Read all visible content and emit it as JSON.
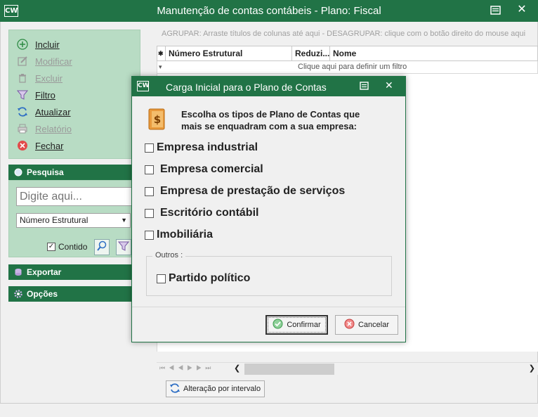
{
  "window": {
    "logo": "CW",
    "title": "Manutenção de contas contábeis - Plano: Fiscal",
    "close_glyph": "✕"
  },
  "actions": [
    {
      "label": "Incluir",
      "enabled": true,
      "icon": "plus-circle-icon"
    },
    {
      "label": "Modificar",
      "enabled": false,
      "icon": "edit-icon"
    },
    {
      "label": "Excluir",
      "enabled": false,
      "icon": "trash-icon"
    },
    {
      "label": "Filtro",
      "enabled": true,
      "icon": "filter-icon"
    },
    {
      "label": "Atualizar",
      "enabled": true,
      "icon": "refresh-icon"
    },
    {
      "label": "Relatório",
      "enabled": false,
      "icon": "printer-icon"
    },
    {
      "label": "Fechar",
      "enabled": true,
      "icon": "close-circle-icon"
    }
  ],
  "pesquisa": {
    "header": "Pesquisa",
    "search_placeholder": "Digite aqui...",
    "field_selected": "Número Estrutural",
    "contido_label": "Contido",
    "contido_checked": true
  },
  "exportar": {
    "header": "Exportar"
  },
  "opcoes": {
    "header": "Opções"
  },
  "grid": {
    "group_hint": "AGRUPAR: Arraste títulos de colunas até aqui - DESAGRUPAR: clique com o botão direito do mouse aqui",
    "columns": [
      "Número Estrutural",
      "Reduzi...",
      "Nome"
    ],
    "row_indicator": "✱",
    "filter_prompt": "Clique aqui para definir um filtro"
  },
  "interval_button": "Alteração por intervalo",
  "dialog": {
    "logo": "CW",
    "title": "Carga Inicial para o Plano de Contas",
    "close_glyph": "✕",
    "intro_line1": "Escolha os tipos de Plano de Contas que",
    "intro_line2": "mais se enquadram com a sua empresa:",
    "options": [
      {
        "label": "Empresa industrial",
        "checked": false
      },
      {
        "label": "Empresa comercial",
        "checked": false
      },
      {
        "label": "Empresa de prestação de serviços",
        "checked": false
      },
      {
        "label": "Escritório contábil",
        "checked": false
      },
      {
        "label": "Imobiliária",
        "checked": false
      }
    ],
    "outros_legend": "Outros :",
    "outros_option": {
      "label": "Partido político",
      "checked": false
    },
    "confirm_label": "Confirmar",
    "cancel_label": "Cancelar"
  },
  "colors": {
    "accent": "#217346",
    "panel": "#b8dcc4"
  }
}
